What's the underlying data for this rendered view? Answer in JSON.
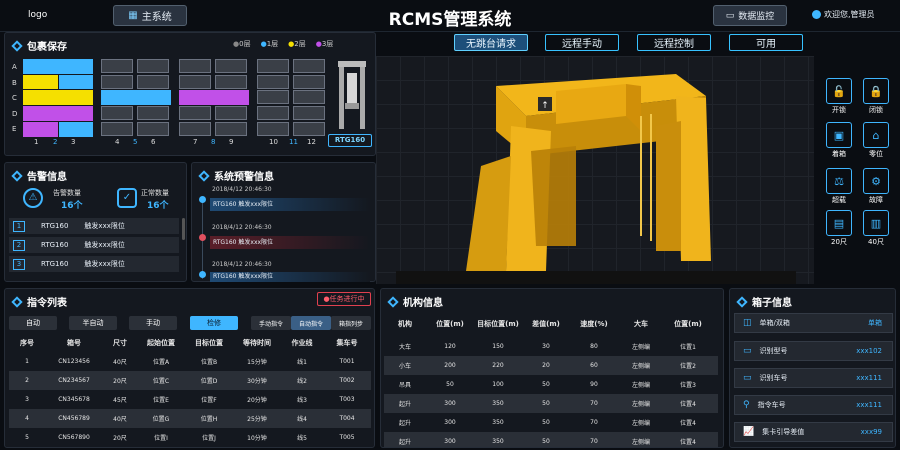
{
  "header": {
    "logo": "logo",
    "main_menu": "主系统",
    "title": "RCMS管理系统",
    "data_monitor": "数据监控",
    "welcome": "欢迎您,管理员"
  },
  "top_buttons": [
    "无跳台请求",
    "远程手动",
    "远程控制",
    "可用"
  ],
  "storage": {
    "title": "包裹保存",
    "legend": [
      {
        "label": "0层",
        "color": "#888888"
      },
      {
        "label": "1层",
        "color": "#3fb6ff"
      },
      {
        "label": "2层",
        "color": "#f5e000"
      },
      {
        "label": "3层",
        "color": "#c150e8"
      }
    ],
    "rows": [
      "A",
      "B",
      "C",
      "D",
      "E"
    ],
    "cols": [
      "1",
      "2",
      "3",
      "4",
      "5",
      "6",
      "7",
      "8",
      "9",
      "10",
      "11",
      "12"
    ],
    "rtg_label": "RTG160"
  },
  "alarm": {
    "title": "告警信息",
    "alarm_label": "告警数量",
    "alarm_value": "16个",
    "normal_label": "正常数量",
    "normal_value": "16个",
    "items": [
      {
        "n": "1",
        "dev": "RTG160",
        "msg": "触发xxx限位"
      },
      {
        "n": "2",
        "dev": "RTG160",
        "msg": "触发xxx限位"
      },
      {
        "n": "3",
        "dev": "RTG160",
        "msg": "触发xxx限位"
      }
    ]
  },
  "warning": {
    "title": "系统预警信息",
    "items": [
      {
        "time": "2018/4/12 20:46:30",
        "msg": "RTG160 触发xxx限位",
        "color": "#1a3350"
      },
      {
        "time": "2018/4/12 20:46:30",
        "msg": "RTG160 触发xxx限位",
        "color": "#4a1a22"
      },
      {
        "time": "2018/4/12 20:46:30",
        "msg": "RTG160 触发xxx限位",
        "color": "#1a3350"
      }
    ]
  },
  "side_buttons": [
    {
      "label": "开锁",
      "icon": "unlock-icon"
    },
    {
      "label": "闭锁",
      "icon": "lock-icon"
    },
    {
      "label": "着箱",
      "icon": "box-land-icon"
    },
    {
      "label": "零位",
      "icon": "zero-icon"
    },
    {
      "label": "超载",
      "icon": "overload-icon"
    },
    {
      "label": "故障",
      "icon": "fault-icon"
    },
    {
      "label": "20尺",
      "icon": "container20-icon"
    },
    {
      "label": "40尺",
      "icon": "container40-icon"
    }
  ],
  "commands": {
    "title": "指令列表",
    "status": "●任务进行中",
    "modes": [
      "自动",
      "半自动",
      "手动",
      "检修"
    ],
    "tabs": [
      "手动指令",
      "自动指令",
      "箱指列步"
    ],
    "headers": [
      "序号",
      "箱号",
      "尺寸",
      "起始位置",
      "目标位置",
      "等待时间",
      "作业线",
      "集车号"
    ],
    "rows": [
      [
        "1",
        "CN123456",
        "40尺",
        "位置A",
        "位置B",
        "15分钟",
        "线1",
        "T001"
      ],
      [
        "2",
        "CN234567",
        "20尺",
        "位置C",
        "位置D",
        "30分钟",
        "线2",
        "T002"
      ],
      [
        "3",
        "CN345678",
        "45尺",
        "位置E",
        "位置F",
        "20分钟",
        "线3",
        "T003"
      ],
      [
        "4",
        "CN456789",
        "40尺",
        "位置G",
        "位置H",
        "25分钟",
        "线4",
        "T004"
      ],
      [
        "5",
        "CN567890",
        "20尺",
        "位置I",
        "位置J",
        "10分钟",
        "线5",
        "T005"
      ]
    ]
  },
  "mechanism": {
    "title": "机构信息",
    "headers": [
      "机构",
      "位置(m)",
      "目标位置(m)",
      "差值(m)",
      "速度(%)",
      "大车",
      "位置(m)"
    ],
    "rows": [
      [
        "大车",
        "120",
        "150",
        "30",
        "80",
        "左侧编",
        "位置1"
      ],
      [
        "小车",
        "200",
        "220",
        "20",
        "60",
        "左侧编",
        "位置2"
      ],
      [
        "吊具",
        "50",
        "100",
        "50",
        "90",
        "左侧编",
        "位置3"
      ],
      [
        "起升",
        "300",
        "350",
        "50",
        "70",
        "左侧编",
        "位置4"
      ],
      [
        "起升",
        "300",
        "350",
        "50",
        "70",
        "左侧编",
        "位置4"
      ],
      [
        "起升",
        "300",
        "350",
        "50",
        "70",
        "左侧编",
        "位置4"
      ]
    ]
  },
  "box_info": {
    "title": "箱子信息",
    "items": [
      {
        "label": "单箱/双箱",
        "value": "单箱"
      },
      {
        "label": "识别型号",
        "value": "xxx102"
      },
      {
        "label": "识别车号",
        "value": "xxx111"
      },
      {
        "label": "指令车号",
        "value": "xxx111"
      },
      {
        "label": "集卡引导差值",
        "value": "xxx99"
      }
    ]
  }
}
